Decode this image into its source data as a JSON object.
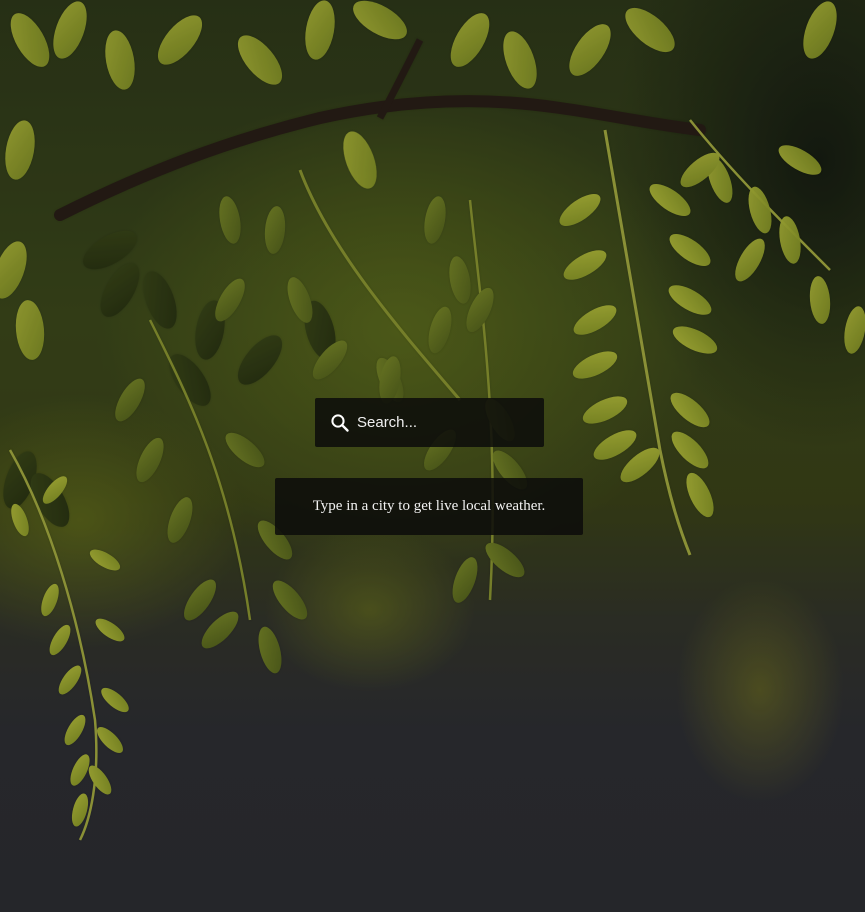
{
  "search": {
    "placeholder": "Search...",
    "value": "",
    "icon": "search-icon"
  },
  "hint": {
    "text": "Type in a city to get live local weather."
  },
  "background": {
    "icon": "foliage-image",
    "colors": {
      "leaf": "#9aa634",
      "leaf_dark": "#5f6c22",
      "leaf_bright": "#b8bc3a",
      "branch": "#2a1f18",
      "ground": "#2f3035",
      "panel": "#0c0c0a"
    }
  }
}
